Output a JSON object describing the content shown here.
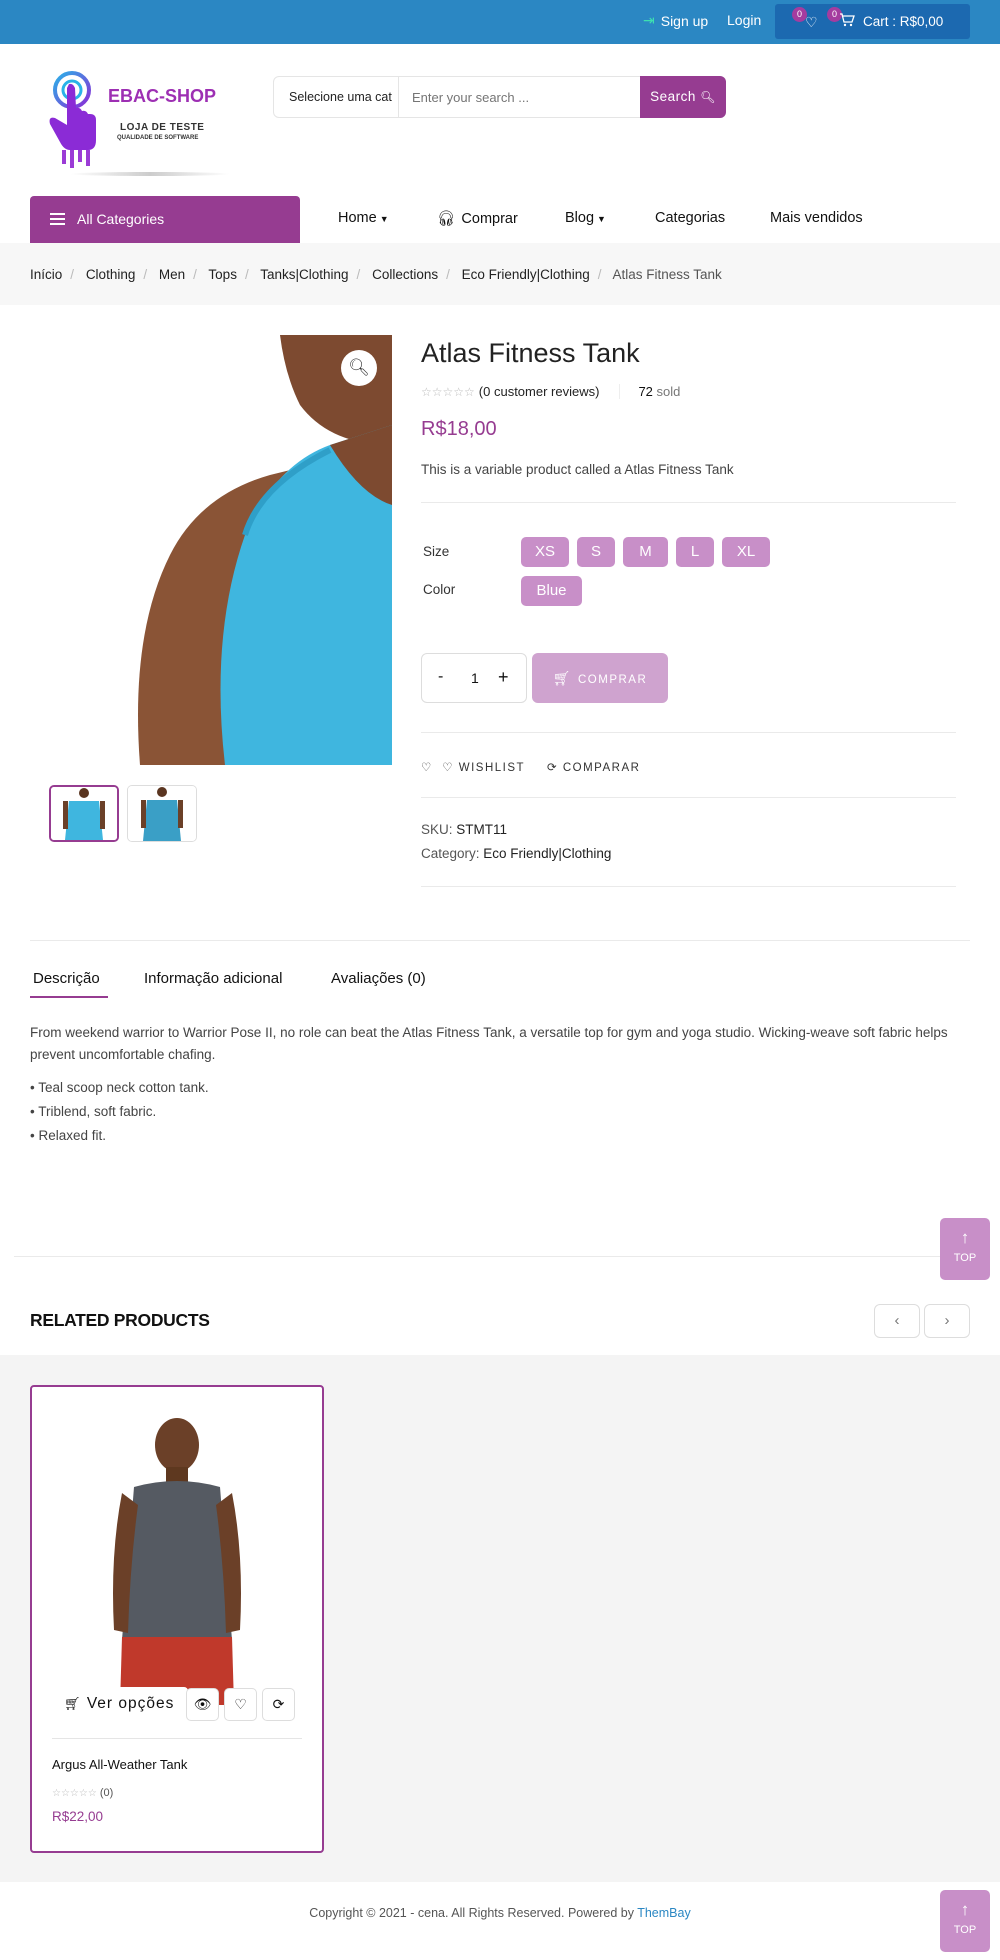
{
  "topbar": {
    "signup": "Sign up",
    "login": "Login",
    "wishlist_count": "0",
    "cart_count": "0",
    "cart_label": "Cart : R$0,00"
  },
  "logo": {
    "brand": "EBAC-SHOP",
    "line1": "LOJA DE TESTE",
    "line2": "QUALIDADE DE SOFTWARE"
  },
  "search": {
    "category": "Selecione uma cat",
    "placeholder": "Enter your search ...",
    "button": "Search"
  },
  "nav": {
    "all_categories": "All Categories",
    "items": [
      "Home",
      "Comprar",
      "Blog",
      "Categorias",
      "Mais vendidos"
    ]
  },
  "breadcrumb": [
    "Início",
    "Clothing",
    "Men",
    "Tops",
    "Tanks|Clothing",
    "Collections",
    "Eco Friendly|Clothing",
    "Atlas Fitness Tank"
  ],
  "product": {
    "title": "Atlas Fitness Tank",
    "rating_stars": 0,
    "reviews": "(0 customer reviews)",
    "sold_count": "72",
    "sold_label": "sold",
    "price": "R$18,00",
    "short_description": "This is a variable product called a Atlas Fitness Tank",
    "size_label": "Size",
    "sizes": [
      "XS",
      "S",
      "M",
      "L",
      "XL"
    ],
    "color_label": "Color",
    "colors": [
      "Blue"
    ],
    "quantity": "1",
    "minus": "-",
    "plus": "+",
    "buy_button": "COMPRAR",
    "wishlist": "WISHLIST",
    "compare": "COMPARAR",
    "sku_label": "SKU:",
    "sku": "STMT11",
    "category_label": "Category:",
    "category": "Eco Friendly|Clothing",
    "shirt_color": "#3fb6df"
  },
  "tabs": {
    "items": [
      "Descrição",
      "Informação adicional",
      "Avaliações (0)"
    ],
    "active": 0
  },
  "description": {
    "text": "From weekend warrior to Warrior Pose II, no role can beat the Atlas Fitness Tank, a versatile top for gym and yoga studio. Wicking-weave soft fabric helps prevent uncomfortable chafing.",
    "bullets": [
      "• Teal scoop neck cotton tank.",
      "• Triblend, soft fabric.",
      "• Relaxed fit."
    ]
  },
  "to_top": "TOP",
  "related": {
    "title": "RELATED PRODUCTS",
    "products": [
      {
        "name": "Argus All-Weather Tank",
        "rating_count": "(0)",
        "price": "R$22,00",
        "options_button": "Ver opções"
      }
    ]
  },
  "footer": {
    "copyright": "Copyright © 2021 - cena. All Rights Reserved. Powered by",
    "powered_by": "ThemBay"
  },
  "colors": {
    "accent": "#963c91",
    "topbar": "#2b87c3",
    "swatch": "#c88fc8"
  }
}
